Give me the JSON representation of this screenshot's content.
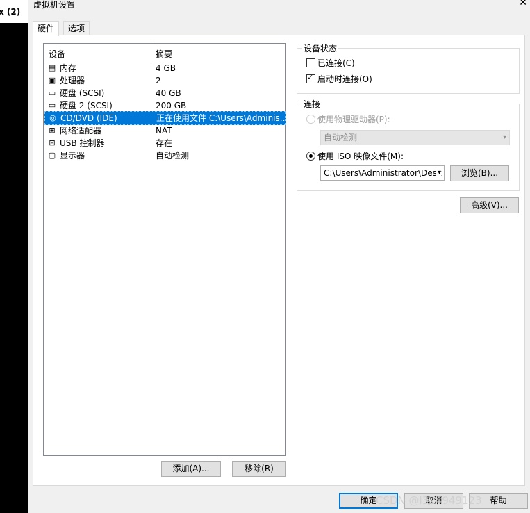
{
  "background_tab": {
    "label": "x (2)"
  },
  "window": {
    "title": "虚拟机设置",
    "close_glyph": "✕"
  },
  "tabs": [
    {
      "label": "硬件",
      "active": true
    },
    {
      "label": "选项",
      "active": false
    }
  ],
  "device_list": {
    "headers": {
      "device": "设备",
      "summary": "摘要"
    },
    "rows": [
      {
        "icon": "memory-icon",
        "name": "内存",
        "summary": "4 GB"
      },
      {
        "icon": "processor-icon",
        "name": "处理器",
        "summary": "2"
      },
      {
        "icon": "hard-disk-icon",
        "name": "硬盘 (SCSI)",
        "summary": "40 GB"
      },
      {
        "icon": "hard-disk-icon",
        "name": "硬盘 2 (SCSI)",
        "summary": "200 GB"
      },
      {
        "icon": "cd-dvd-icon",
        "name": "CD/DVD (IDE)",
        "summary": "正在使用文件 C:\\Users\\Adminis...",
        "selected": true
      },
      {
        "icon": "network-adapter-icon",
        "name": "网络适配器",
        "summary": "NAT"
      },
      {
        "icon": "usb-controller-icon",
        "name": "USB 控制器",
        "summary": "存在"
      },
      {
        "icon": "display-icon",
        "name": "显示器",
        "summary": "自动检测"
      }
    ],
    "add_label": "添加(A)...",
    "remove_label": "移除(R)"
  },
  "device_status": {
    "title": "设备状态",
    "connected": {
      "label": "已连接(C)",
      "checked": false
    },
    "connect_at_power_on": {
      "label": "启动时连接(O)",
      "checked": true
    }
  },
  "connection": {
    "title": "连接",
    "physical_drive": {
      "label": "使用物理驱动器(P):",
      "selected": false,
      "disabled": true
    },
    "physical_drive_select": {
      "value": "自动检测"
    },
    "iso_image": {
      "label": "使用 ISO 映像文件(M):",
      "selected": true
    },
    "iso_path": {
      "value": "C:\\Users\\Administrator\\Desk"
    },
    "browse_label": "浏览(B)..."
  },
  "advanced_label": "高级(V)...",
  "footer": {
    "ok_label": "确定",
    "cancel_label": "取消",
    "help_label": "帮助"
  },
  "watermark": "CSDN @l324949123",
  "colors": {
    "selection": "#0078d7",
    "panel_bg": "#f0f0f0"
  }
}
